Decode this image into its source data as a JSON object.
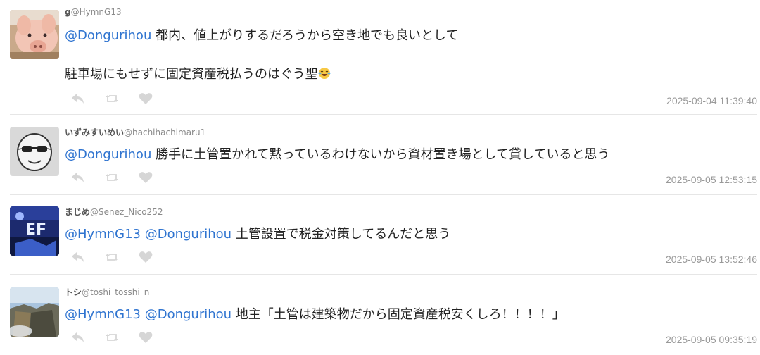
{
  "posts": [
    {
      "display_name": "g",
      "handle": "@HymnG13",
      "mentions": "@Dongurihou",
      "text_line1": " 都内、値上がりするだろうから空き地でも良いとして",
      "text_line2": "駐車場にもせずに固定資産税払うのはぐう聖",
      "emoji_icon": "laughing-tears-emoji",
      "timestamp": "2025-09-04 11:39:40",
      "avatar_icon": "pig-photo"
    },
    {
      "display_name": "いずみすいめい",
      "handle": "@hachihachimaru1",
      "mentions": "@Dongurihou",
      "text": " 勝手に土管置かれて黙っているわけないから資材置き場として貸していると思う",
      "timestamp": "2025-09-05 12:53:15",
      "avatar_icon": "sunglasses-face-drawing"
    },
    {
      "display_name": "まじめ",
      "handle": "@Senez_Nico252",
      "mentions": "@HymnG13 @Dongurihou",
      "text": " 土管設置で税金対策してるんだと思う",
      "timestamp": "2025-09-05 13:52:46",
      "avatar_icon": "blue-poster-photo"
    },
    {
      "display_name": "トシ",
      "handle": "@toshi_tosshi_n",
      "mentions": "@HymnG13 @Dongurihou",
      "text": " 地主「土管は建築物だから固定資産税安くしろ！！！！」",
      "timestamp": "2025-09-05 09:35:19",
      "avatar_icon": "cliff-landscape-photo"
    }
  ],
  "actions": {
    "reply_icon": "reply-icon",
    "retweet_icon": "retweet-icon",
    "like_icon": "heart-icon"
  },
  "colors": {
    "mention": "#2f74d0",
    "text": "#222222",
    "meta": "#999999",
    "action_icon": "#d6d6d6",
    "divider": "#e6e6e6"
  }
}
